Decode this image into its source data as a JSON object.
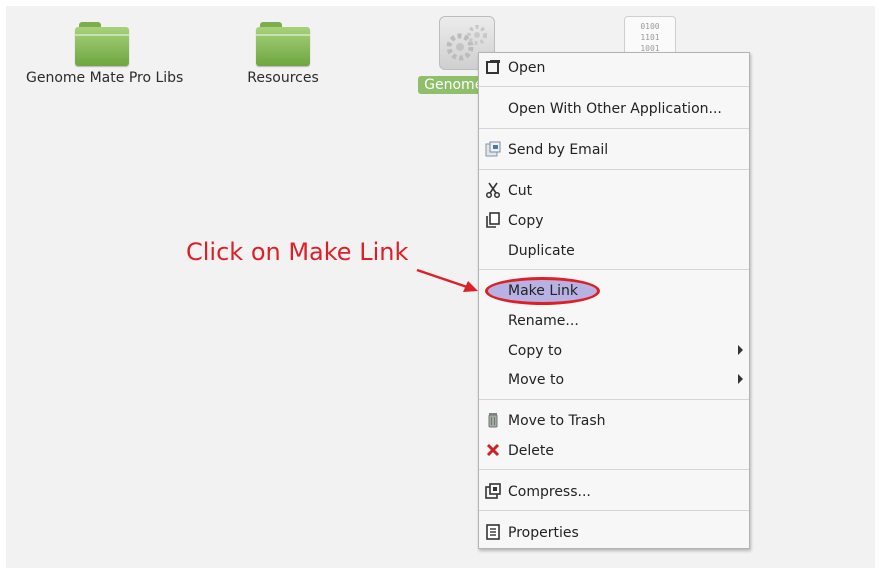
{
  "desktop": {
    "icons": [
      {
        "label": "Genome Mate Pro Libs",
        "icon": "folder-icon"
      },
      {
        "label": "Resources",
        "icon": "folder-icon"
      },
      {
        "label": "Genome M",
        "icon": "application-icon",
        "selected": true
      },
      {
        "binary_lines": [
          "0100",
          "1101",
          "1001"
        ],
        "icon": "binary-file-icon"
      }
    ]
  },
  "context_menu": {
    "items": [
      {
        "label": "Open",
        "icon": "open-window-icon"
      },
      {
        "label": "Open With Other Application..."
      },
      {
        "label": "Send by Email",
        "icon": "email-icon"
      },
      {
        "label": "Cut",
        "icon": "scissors-icon"
      },
      {
        "label": "Copy",
        "icon": "copy-icon"
      },
      {
        "label": "Duplicate"
      },
      {
        "label": "Make Link",
        "highlighted": true
      },
      {
        "label": "Rename..."
      },
      {
        "label": "Copy to",
        "submenu": true
      },
      {
        "label": "Move to",
        "submenu": true
      },
      {
        "label": "Move to Trash",
        "icon": "trash-icon"
      },
      {
        "label": "Delete",
        "icon": "delete-x-icon"
      },
      {
        "label": "Compress...",
        "icon": "compress-icon"
      },
      {
        "label": "Properties",
        "icon": "properties-icon"
      }
    ]
  },
  "annotation": {
    "text": "Click on Make Link",
    "color": "#dd1f26"
  },
  "colors": {
    "folder": "#7cae4d",
    "selection": "#8fbf6a",
    "highlight": "#b7b2e3"
  }
}
